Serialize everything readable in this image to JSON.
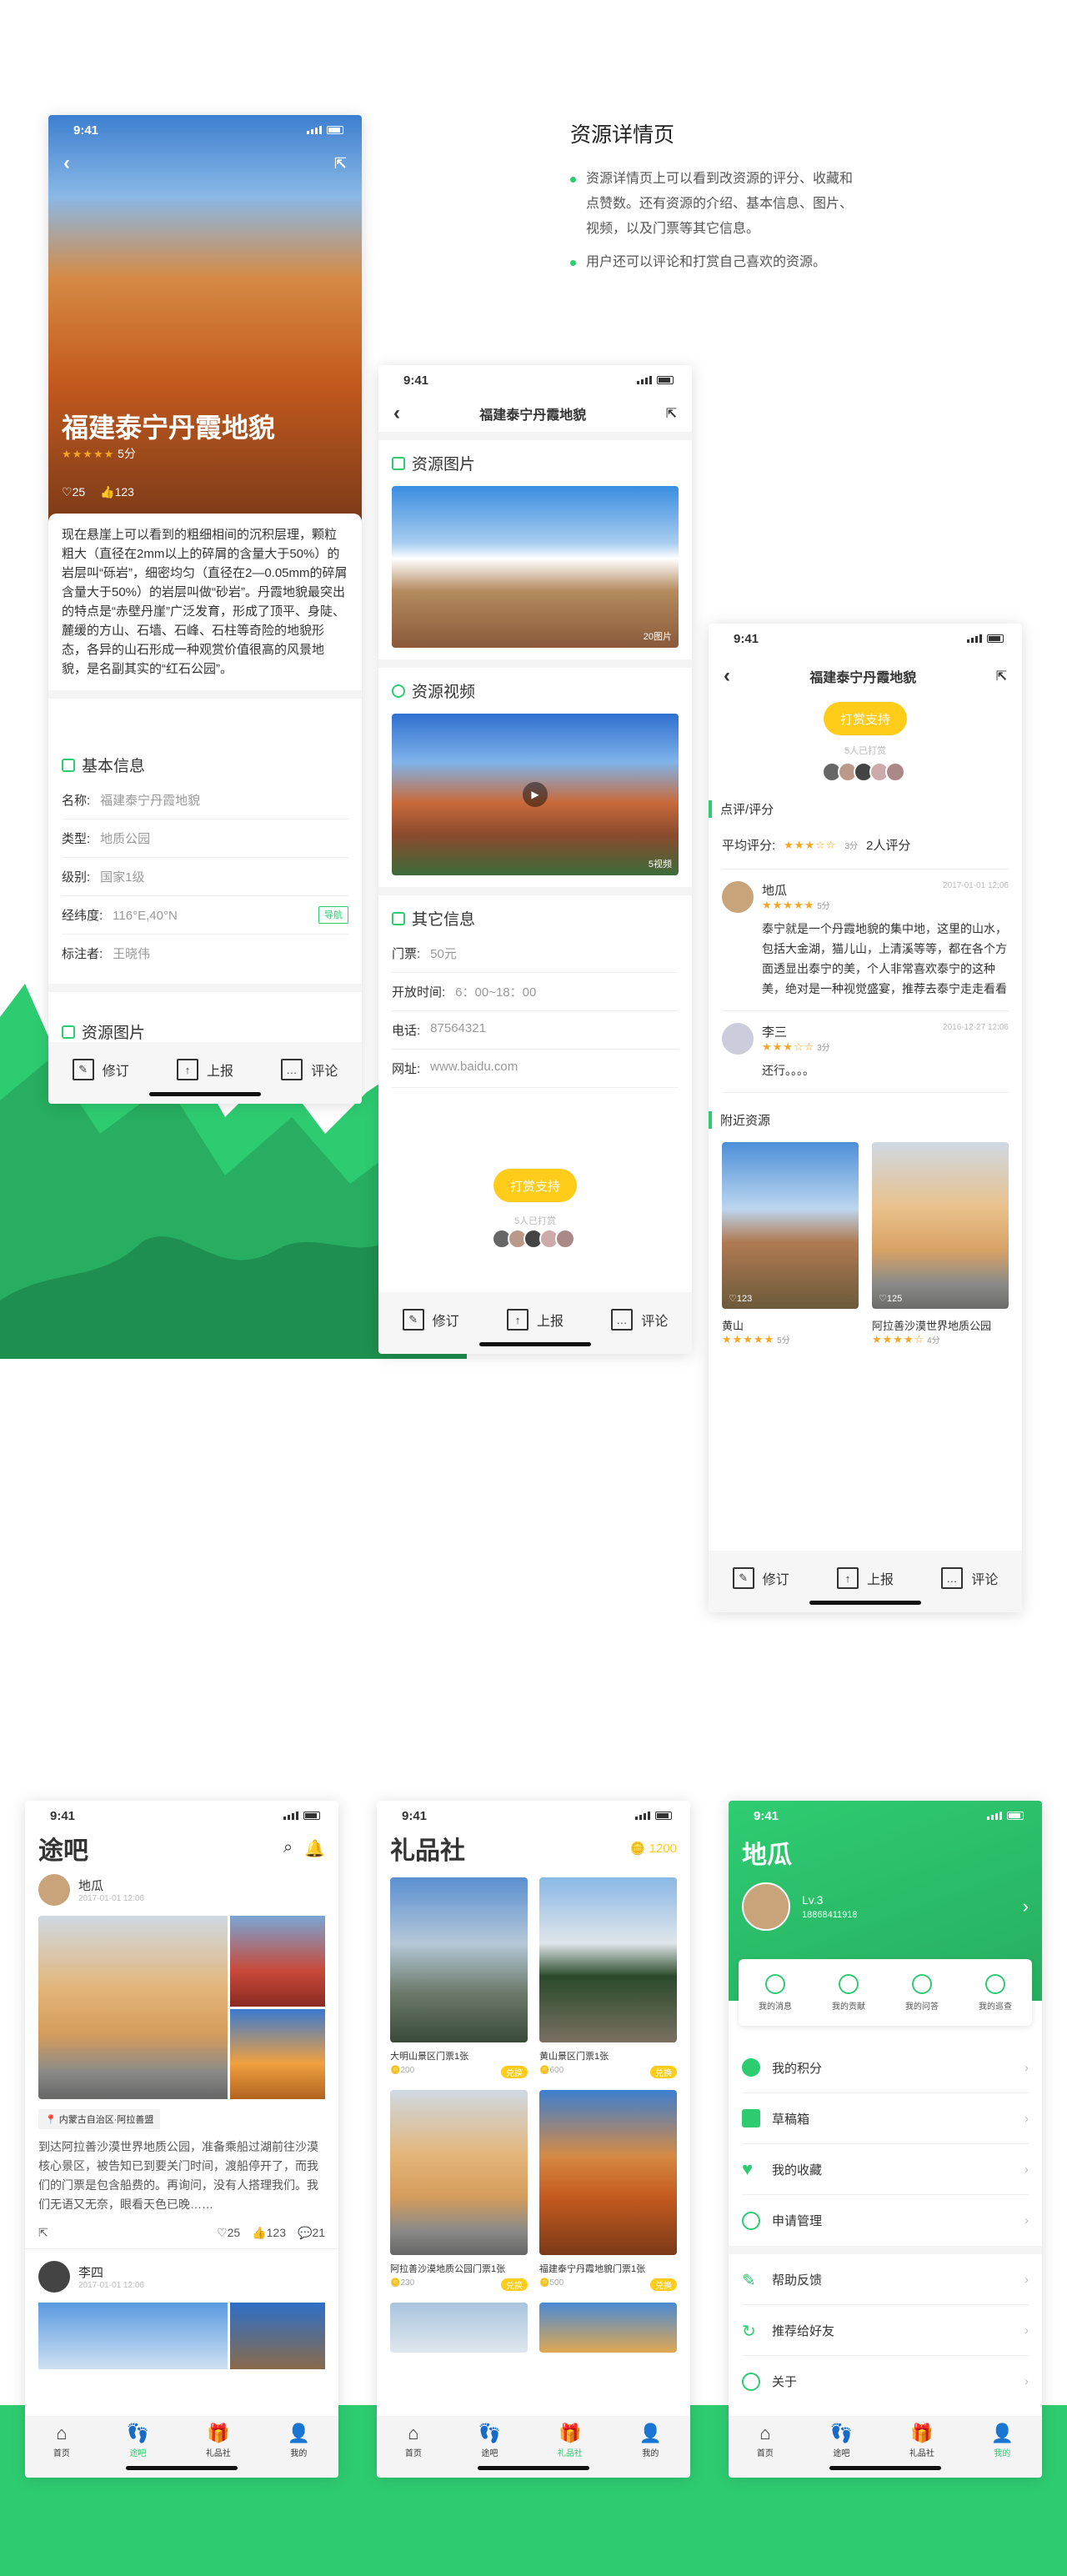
{
  "intro": {
    "title": "资源详情页",
    "bullets": [
      "资源详情页上可以看到改资源的评分、收藏和点赞数。还有资源的介绍、基本信息、图片、视频，以及门票等其它信息。",
      "用户还可以评论和打赏自己喜欢的资源。"
    ]
  },
  "status_time": "9:41",
  "resource": {
    "name": "福建泰宁丹霞地貌",
    "score": "5分",
    "likes": "25",
    "thumbs": "123",
    "desc": "现在悬崖上可以看到的粗细相间的沉积层理，颗粒粗大（直径在2mm以上的碎屑的含量大于50%）的岩层叫“砾岩”，细密均匀（直径在2—0.05mm的碎屑含量大于50%）的岩层叫做“砂岩”。丹霞地貌最突出的特点是“赤壁丹崖”广泛发育，形成了顶平、身陡、麓缓的方山、石墙、石峰、石柱等奇险的地貌形态，各异的山石形成一种观赏价值很高的风景地貌，是名副其实的“红石公园”。"
  },
  "basic": {
    "title": "基本信息",
    "rows": [
      {
        "k": "名称:",
        "v": "福建泰宁丹霞地貌"
      },
      {
        "k": "类型:",
        "v": "地质公园"
      },
      {
        "k": "级别:",
        "v": "国家1级"
      },
      {
        "k": "经纬度:",
        "v": "116°E,40°N"
      },
      {
        "k": "标注者:",
        "v": "王晓伟"
      }
    ],
    "nav_label": "导航",
    "next_section": "资源图片"
  },
  "actions": {
    "edit": "修订",
    "report": "上报",
    "comment": "评论"
  },
  "detail2": {
    "photos_title": "资源图片",
    "photos_count": "20图片",
    "videos_title": "资源视频",
    "videos_count": "5视频",
    "other_title": "其它信息",
    "rows": [
      {
        "k": "门票:",
        "v": "50元"
      },
      {
        "k": "开放时间:",
        "v": "6：00~18：00"
      },
      {
        "k": "电话:",
        "v": "87564321"
      },
      {
        "k": "网址:",
        "v": "www.baidu.com"
      }
    ]
  },
  "tip": {
    "button": "打赏支持",
    "count": "5人已打赏"
  },
  "reviews": {
    "section": "点评/评分",
    "avg_label": "平均评分:",
    "avg_score": "3分",
    "count": "2人评分",
    "items": [
      {
        "name": "地瓜",
        "time": "2017-01-01 12:06",
        "score": "5分",
        "text": "泰宁就是一个丹霞地貌的集中地，这里的山水，包括大金湖，猫儿山，上清溪等等，都在各个方面透显出泰宁的美，个人非常喜欢泰宁的这种美，绝对是一种视觉盛宴，推荐去泰宁走走看看"
      },
      {
        "name": "李三",
        "time": "2016-12-27 12:06",
        "score": "3分",
        "text": "还行。。。。"
      }
    ],
    "nearby_title": "附近资源",
    "nearby": [
      {
        "name": "黄山",
        "likes": "123",
        "score": "5分"
      },
      {
        "name": "阿拉善沙漠世界地质公园",
        "likes": "125",
        "score": "4分"
      }
    ]
  },
  "feed": {
    "title": "途吧",
    "posts": [
      {
        "name": "地瓜",
        "time": "2017-01-01 12:06",
        "location": "内蒙古自治区·阿拉善盟",
        "text": "到达阿拉善沙漠世界地质公园，准备乘船过湖前往沙漠核心景区，被告知已到要关门时间，渡船停开了，而我们的门票是包含船费的。再询问，没有人搭理我们。我们无语又无奈，眼看天色已晚……",
        "likes": "25",
        "thumbs": "123",
        "comments": "21"
      },
      {
        "name": "李四",
        "time": "2017-01-01 12:06"
      }
    ]
  },
  "shop": {
    "title": "礼品社",
    "points": "1200",
    "badge": "兑换",
    "items": [
      {
        "name": "大明山景区门票1张",
        "price": "200"
      },
      {
        "name": "黄山景区门票1张",
        "price": "600"
      },
      {
        "name": "阿拉善沙漠地质公园门票1张",
        "price": "230"
      },
      {
        "name": "福建泰宁丹霞地貌门票1张",
        "price": "500"
      }
    ]
  },
  "profile": {
    "title": "地瓜",
    "level": "Lv.3",
    "phone": "18868411918",
    "quick": [
      "我的消息",
      "我的贡献",
      "我的问答",
      "我的巡查"
    ],
    "menu1": [
      "我的积分",
      "草稿箱",
      "我的收藏",
      "申请管理"
    ],
    "menu2": [
      "帮助反馈",
      "推荐给好友",
      "关于"
    ]
  },
  "tabs": [
    "首页",
    "途吧",
    "礼品社",
    "我的"
  ],
  "colors": {
    "green": "#2ecc71",
    "yellow": "#ffcc1a",
    "star": "#f5a623"
  }
}
